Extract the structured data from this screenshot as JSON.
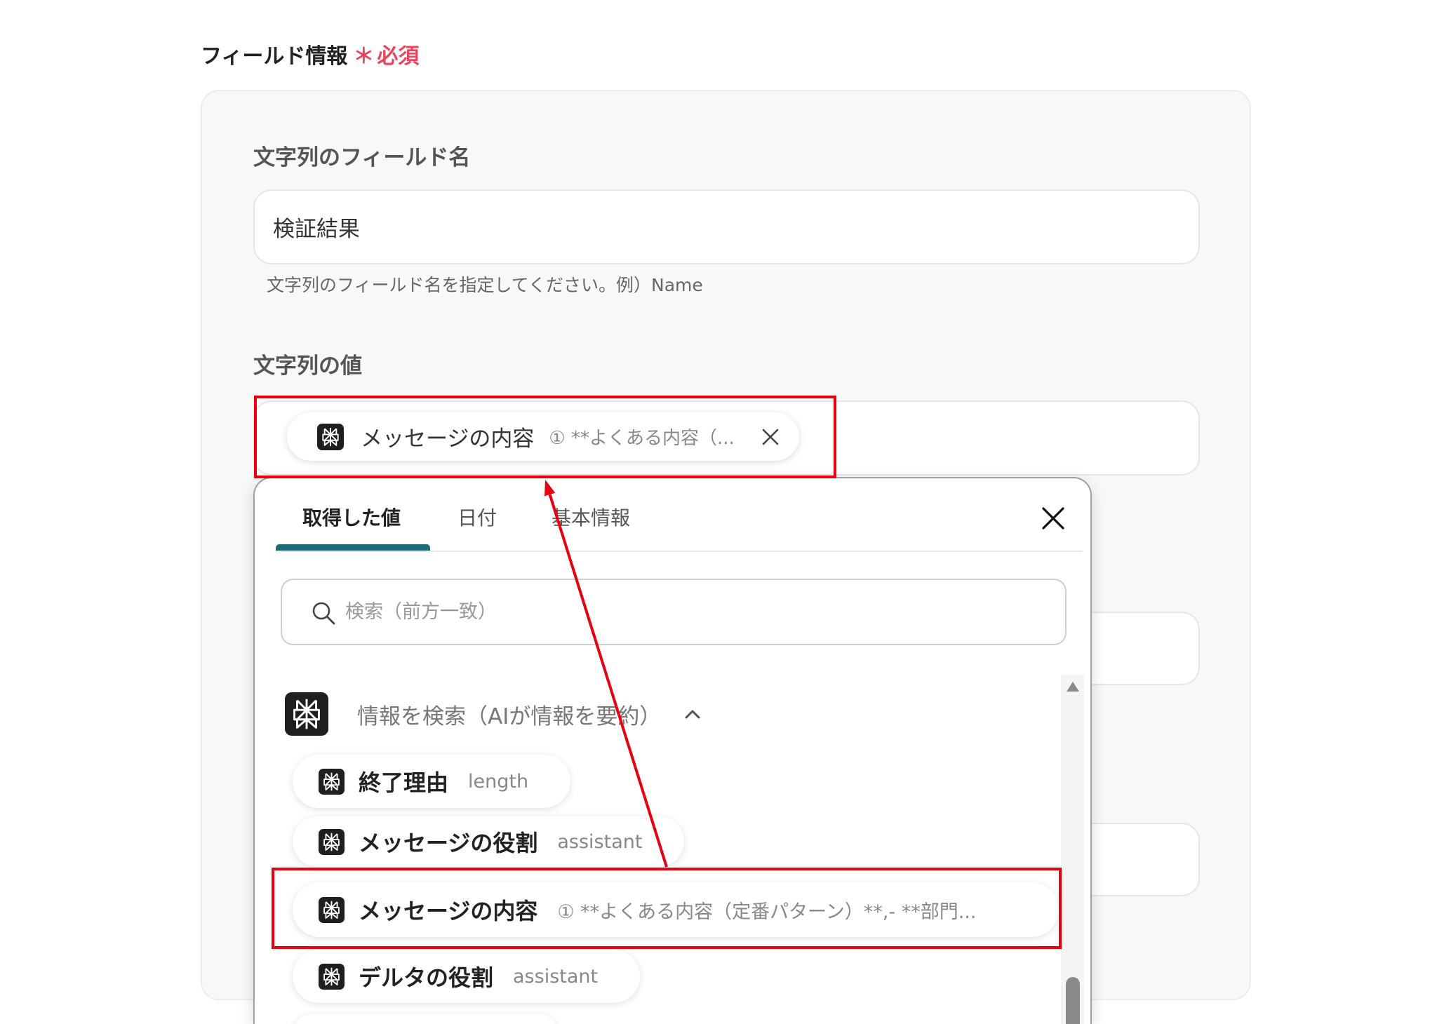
{
  "section": {
    "title": "フィールド情報",
    "required_mark": "＊",
    "required_text": "必須"
  },
  "fields": {
    "name": {
      "label": "文字列のフィールド名",
      "value": "検証結果",
      "help": "文字列のフィールド名を指定してください。例）Name"
    },
    "value": {
      "label": "文字列の値",
      "chip": {
        "icon": "perplexity-icon",
        "label": "メッセージの内容",
        "preview": "① **よくある内容（..."
      }
    }
  },
  "popup": {
    "tabs": [
      "取得した値",
      "日付",
      "基本情報"
    ],
    "active_tab": "取得した値",
    "search_placeholder": "検索（前方一致）",
    "group": {
      "icon": "perplexity-icon",
      "title": "情報を検索（AIが情報を要約）",
      "expanded": true
    },
    "items": [
      {
        "label": "終了理由",
        "value": "length"
      },
      {
        "label": "メッセージの役割",
        "value": "assistant"
      },
      {
        "label": "メッセージの内容",
        "value": "① **よくある内容（定番パターン）**,- **部門..."
      },
      {
        "label": "デルタの役割",
        "value": "assistant"
      }
    ]
  },
  "colors": {
    "accent": "#1d6a7f",
    "required": "#e8465f",
    "annotation": "#e60012"
  }
}
